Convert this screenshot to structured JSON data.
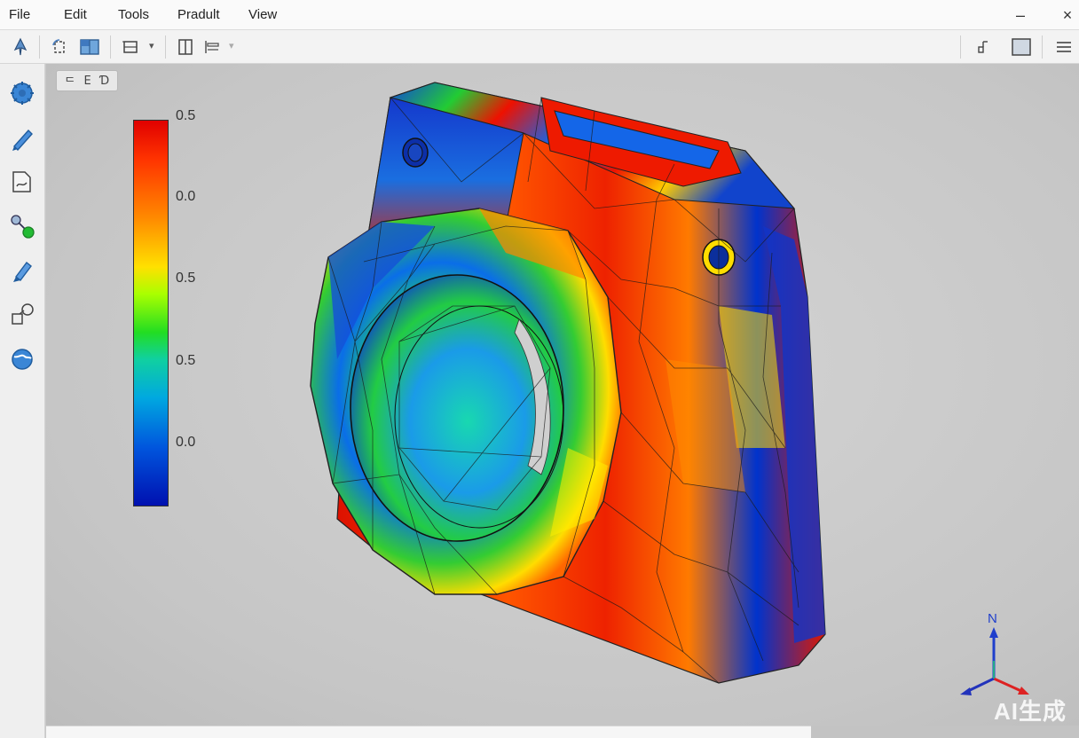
{
  "menubar": {
    "items": [
      "File",
      "Edit",
      "Tools",
      "Pradult",
      "View"
    ],
    "minimize_glyph": "–",
    "close_glyph": "×"
  },
  "toolbar": {
    "left_icons": [
      "select-arrow-icon",
      "rotate-icon",
      "view-cube-icon",
      "fit-view-icon",
      "split-view-icon",
      "section-icon"
    ],
    "right_icons": [
      "pin-icon",
      "panel-icon",
      "hamburger-menu-icon"
    ]
  },
  "sidebar": {
    "icons": [
      "gear-icon",
      "pen-icon",
      "document-icon",
      "probe-icon",
      "brush-icon",
      "transform-icon",
      "globe-icon"
    ]
  },
  "viewport": {
    "view_modes": [
      "ᄃ",
      "E",
      "Ɗ"
    ],
    "legend": {
      "ticks": [
        "0.5",
        "0.0",
        "0.5",
        "0.5",
        "0.0"
      ],
      "colors": [
        "#e00000",
        "#ff8800",
        "#ffe000",
        "#22dd22",
        "#00a8e0",
        "#0010b0"
      ]
    },
    "triad": {
      "north_label": "N"
    }
  },
  "watermark": {
    "text": "AI生成"
  }
}
